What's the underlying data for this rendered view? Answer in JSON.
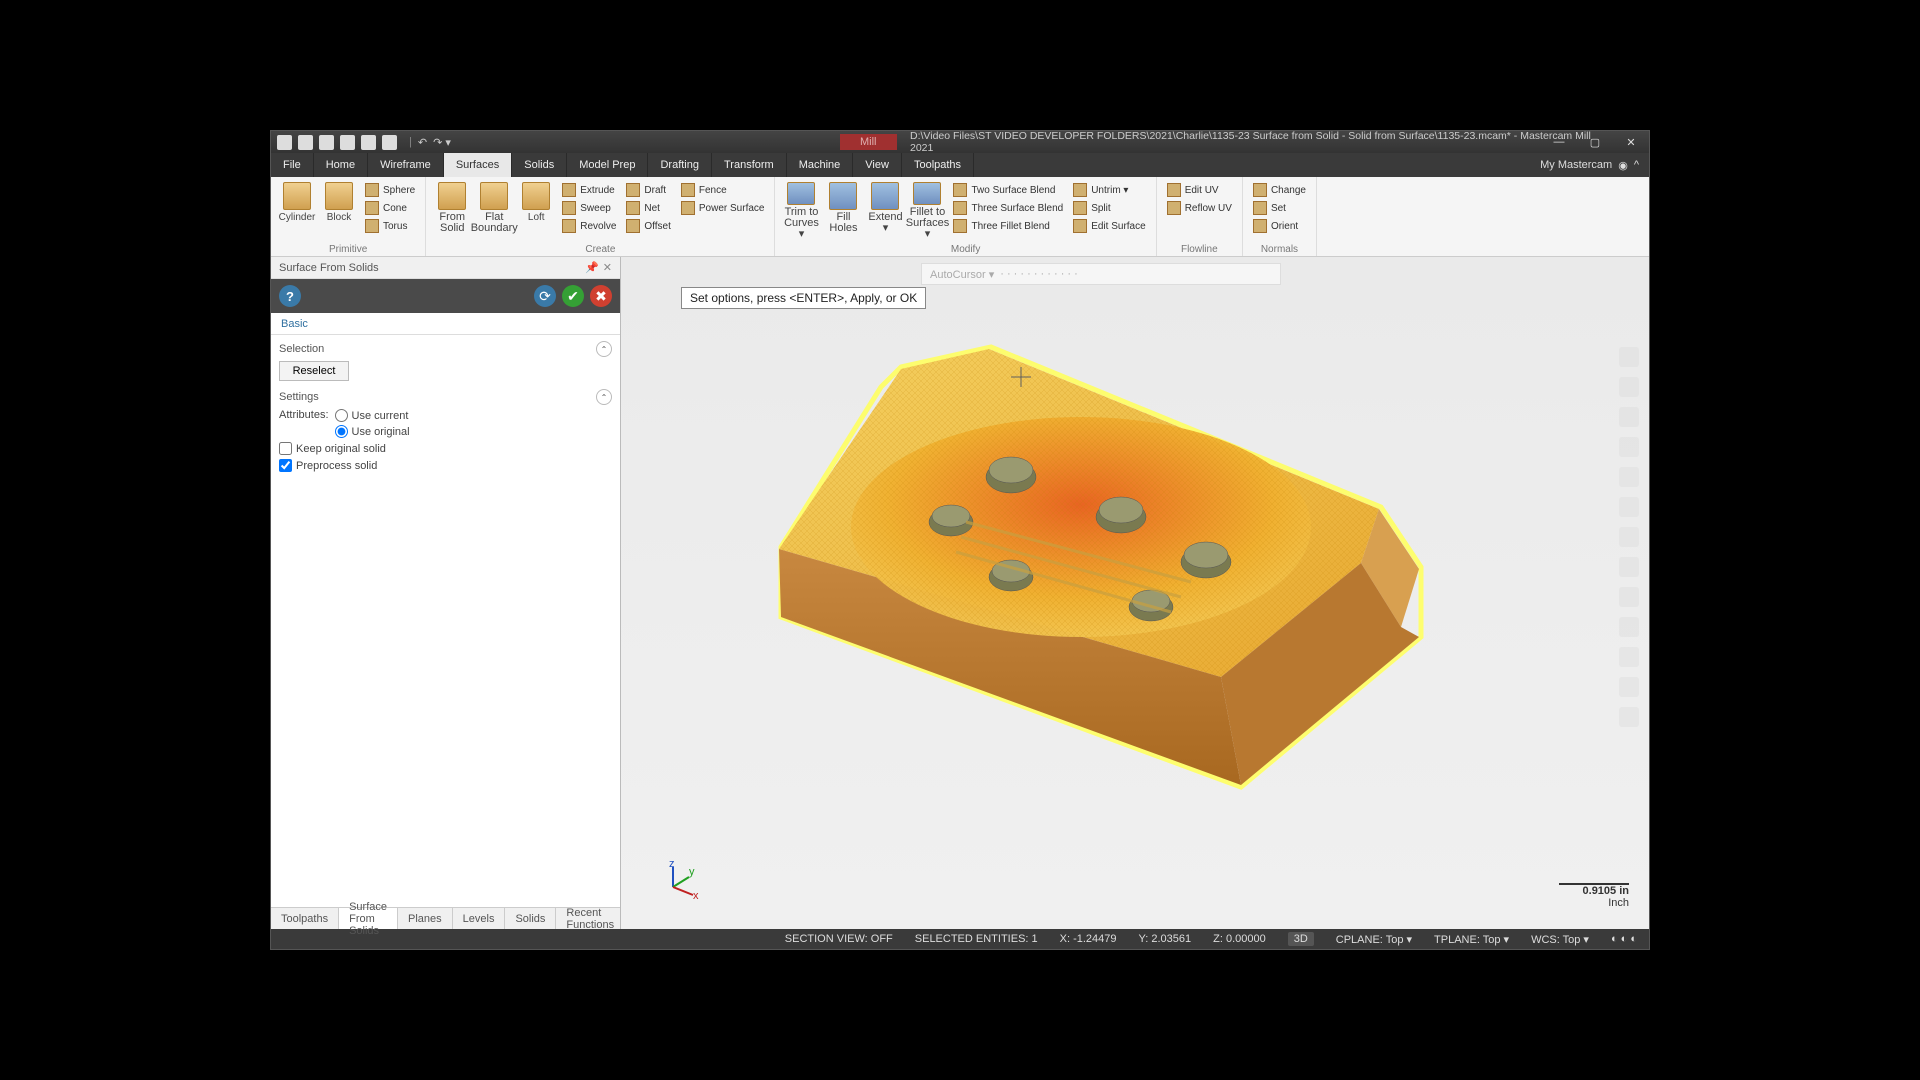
{
  "title_path": "D:\\Video Files\\ST VIDEO DEVELOPER FOLDERS\\2021\\Charlie\\1135-23 Surface from Solid - Solid from Surface\\1135-23.mcam* - Mastercam Mill 2021",
  "mill_tab": "Mill",
  "menu": {
    "file": "File",
    "items": [
      "Home",
      "Wireframe",
      "Surfaces",
      "Solids",
      "Model Prep",
      "Drafting",
      "Transform",
      "Machine",
      "View",
      "Toolpaths"
    ],
    "active": "Surfaces",
    "mymc": "My Mastercam"
  },
  "ribbon": {
    "primitive": {
      "title": "Primitive",
      "big": [
        "Cylinder",
        "Block"
      ],
      "small": [
        "Sphere",
        "Cone",
        "Torus"
      ]
    },
    "create": {
      "title": "Create",
      "big": [
        {
          "l1": "From",
          "l2": "Solid"
        },
        {
          "l1": "Flat",
          "l2": "Boundary"
        },
        {
          "l1": "Loft",
          "l2": ""
        }
      ],
      "col1": [
        "Extrude",
        "Sweep",
        "Revolve"
      ],
      "col2": [
        "Draft",
        "Net",
        "Offset"
      ],
      "col3": [
        "Fence",
        "Power Surface",
        ""
      ]
    },
    "modify": {
      "title": "Modify",
      "big": [
        {
          "l1": "Trim to",
          "l2": "Curves ▾"
        },
        {
          "l1": "Fill",
          "l2": "Holes"
        },
        {
          "l1": "Extend",
          "l2": "▾"
        },
        {
          "l1": "Fillet to",
          "l2": "Surfaces ▾"
        }
      ],
      "col1": [
        "Two Surface Blend",
        "Three Surface Blend",
        "Three Fillet Blend"
      ],
      "col2": [
        "Untrim ▾",
        "Split",
        "Edit Surface"
      ]
    },
    "flowline": {
      "title": "Flowline",
      "col": [
        "Edit UV",
        "Reflow UV",
        ""
      ]
    },
    "normals": {
      "title": "Normals",
      "col": [
        "Change",
        "Set",
        "Orient"
      ]
    }
  },
  "panel": {
    "title": "Surface From Solids",
    "basic": "Basic",
    "selection": "Selection",
    "reselect": "Reselect",
    "settings": "Settings",
    "attributes": "Attributes:",
    "use_current": "Use current",
    "use_original": "Use original",
    "keep": "Keep original solid",
    "preproc": "Preprocess solid"
  },
  "hint": "Set options, press <ENTER>, Apply, or OK",
  "autocursor": "AutoCursor ▾",
  "bottom_tabs": [
    "Toolpaths",
    "Surface From Solids",
    "Planes",
    "Levels",
    "Solids",
    "Recent Functions"
  ],
  "bottom_active": "Surface From Solids",
  "scale": {
    "val": "0.9105 in",
    "unit": "Inch"
  },
  "status": {
    "section": "SECTION VIEW: OFF",
    "sel": "SELECTED ENTITIES: 1",
    "x": "X: -1.24479",
    "y": "Y: 2.03561",
    "z": "Z: 0.00000",
    "d": "3D",
    "cplane": "CPLANE: Top ▾",
    "tplane": "TPLANE: Top ▾",
    "wcs": "WCS: Top ▾"
  }
}
